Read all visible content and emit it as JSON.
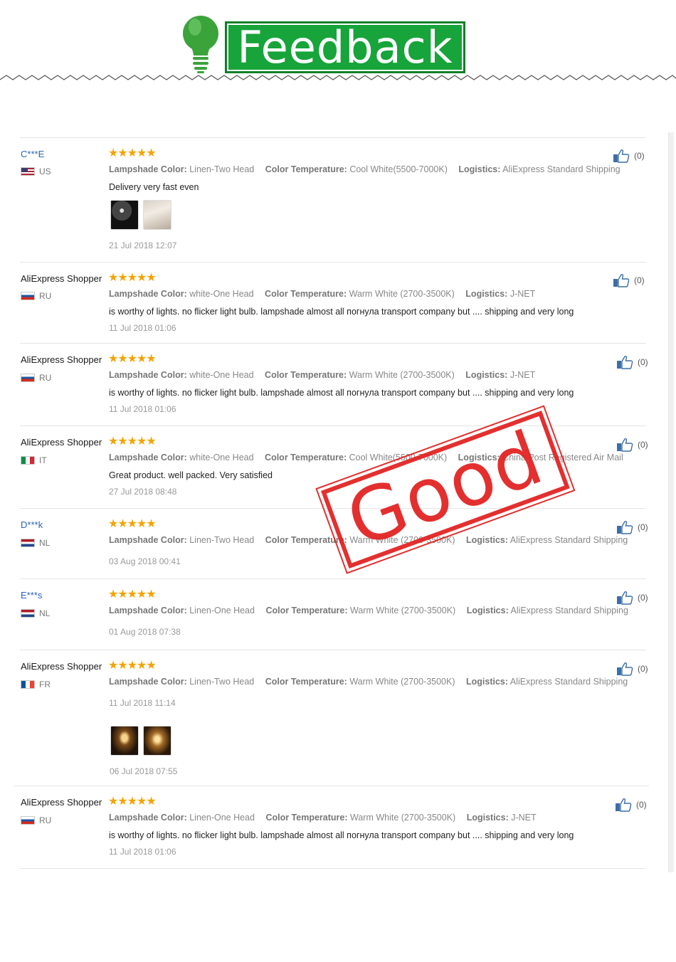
{
  "header": {
    "title": "Feedback"
  },
  "colors": {
    "accent_green": "#17a43a",
    "star": "#f4a300",
    "stamp_red": "#e32020",
    "masked_name": "#2a64b4"
  },
  "labels": {
    "lampshade": "Lampshade Color:",
    "temperature": "Color Temperature:",
    "logistics": "Logistics:"
  },
  "stamp": {
    "text": "Good"
  },
  "reviews": [
    {
      "user": "C***E",
      "country": "US",
      "stars": "★★★★★",
      "lampshade": "Linen-Two Head",
      "temperature": "Cool White(5500-7000K)",
      "logistics": "AliExpress Standard Shipping",
      "comment": "Delivery very fast even",
      "date": "21 Jul 2018 12:07",
      "likes": "(0)",
      "images": [
        "review-photo-1",
        "review-photo-2"
      ]
    },
    {
      "user": "AliExpress Shopper",
      "country": "RU",
      "stars": "★★★★★",
      "lampshade": "white-One Head",
      "temperature": "Warm White (2700-3500K)",
      "logistics": "J-NET",
      "comment": "is worthy of lights. no flicker light bulb. lampshade almost all погнула transport company but .... shipping and very long",
      "date": "11 Jul 2018 01:06",
      "likes": "(0)"
    },
    {
      "user": "AliExpress Shopper",
      "country": "RU",
      "stars": "★★★★★",
      "lampshade": "white-One Head",
      "temperature": "Warm White (2700-3500K)",
      "logistics": "J-NET",
      "comment": "is worthy of lights. no flicker light bulb. lampshade almost all погнула transport company but .... shipping and very long",
      "date": "11 Jul 2018 01:06",
      "likes": "(0)"
    },
    {
      "user": "AliExpress Shopper",
      "country": "IT",
      "stars": "★★★★★",
      "lampshade": "white-One Head",
      "temperature": "Cool White(5500-7000K)",
      "logistics": "China Post Registered Air Mail",
      "comment": "Great product. well packed. Very satisfied",
      "date": "27 Jul 2018 08:48",
      "likes": "(0)"
    },
    {
      "user": "D***k",
      "country": "NL",
      "stars": "★★★★★",
      "lampshade": "Linen-Two Head",
      "temperature": "Warm White (2700-3500K)",
      "logistics": "AliExpress Standard Shipping",
      "date": "03 Aug 2018 00:41",
      "likes": "(0)"
    },
    {
      "user": "E***s",
      "country": "NL",
      "stars": "★★★★★",
      "lampshade": "Linen-One Head",
      "temperature": "Warm White (2700-3500K)",
      "logistics": "AliExpress Standard Shipping",
      "date": "01 Aug 2018 07:38",
      "likes": "(0)"
    },
    {
      "user": "AliExpress Shopper",
      "country": "FR",
      "stars": "★★★★★",
      "lampshade": "Linen-Two Head",
      "temperature": "Warm White (2700-3500K)",
      "logistics": "AliExpress Standard Shipping",
      "date": "11 Jul 2018 11:14",
      "additional_date": "06 Jul 2018 07:55",
      "likes": "(0)",
      "images": [
        "review-photo-1",
        "review-photo-2"
      ]
    },
    {
      "user": "AliExpress Shopper",
      "country": "RU",
      "stars": "★★★★★",
      "lampshade": "Linen-One Head",
      "temperature": "Warm White (2700-3500K)",
      "logistics": "J-NET",
      "comment": "is worthy of lights. no flicker light bulb. lampshade almost all погнула transport company but .... shipping and very long",
      "date": "11 Jul 2018 01:06",
      "likes": "(0)"
    }
  ]
}
